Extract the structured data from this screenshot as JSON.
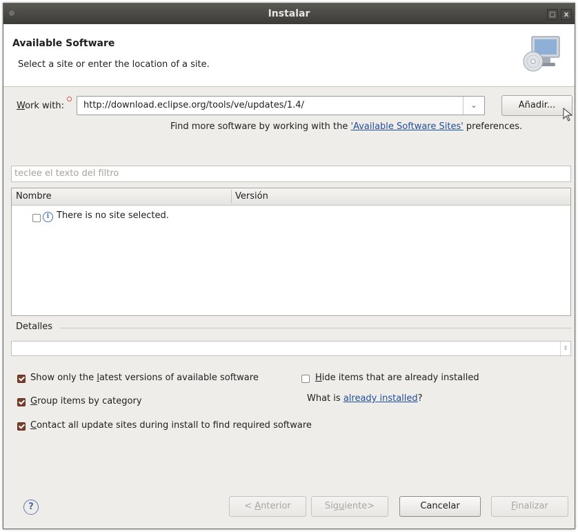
{
  "window": {
    "title": "Instalar",
    "restore_glyph": "◻",
    "close_glyph": "x"
  },
  "header": {
    "title": "Available Software",
    "subtitle": "Select a site or enter the location of a site.",
    "icon": "monitor-cd-icon"
  },
  "work_with": {
    "label_pre": "",
    "label_u": "W",
    "label_post": "ork with:",
    "value": "http://download.eclipse.org/tools/ve/updates/1.4/",
    "caret": "⌄",
    "add_button": "Añadir...",
    "find_more_pre": "Find more software by working with the ",
    "find_more_link": "'Available Software Sites'",
    "find_more_post": " preferences."
  },
  "filter": {
    "placeholder": "teclee el texto del filtro"
  },
  "tree": {
    "columns": [
      "Nombre",
      "Versión"
    ],
    "rows": [
      {
        "label": "There is no site selected.",
        "checked": false,
        "icon": "info-icon",
        "icon_glyph": "i"
      }
    ]
  },
  "details": {
    "label": "Detalles",
    "scroll_glyph": "⇕"
  },
  "options": {
    "latest": {
      "pre": "Show only the ",
      "u": "l",
      "post": "atest versions of available software",
      "checked": true
    },
    "hide_installed": {
      "pre": "",
      "u": "H",
      "post": "ide items that are already installed",
      "checked": false
    },
    "group": {
      "pre": "",
      "u": "G",
      "post": "roup items by category",
      "checked": true
    },
    "what_is_pre": "What is ",
    "what_is_link": "already installed",
    "what_is_post": "?",
    "contact": {
      "pre": "",
      "u": "C",
      "post": "ontact all update sites during install to find required software",
      "checked": true
    }
  },
  "footer": {
    "help_glyph": "?",
    "back": {
      "pre": "< ",
      "u": "A",
      "post": "nterior",
      "enabled": false
    },
    "next": {
      "pre": "Sig",
      "u": "u",
      "post": "iente>",
      "enabled": false
    },
    "cancel": {
      "label": "Cancelar",
      "enabled": true
    },
    "finish": {
      "pre": "",
      "u": "F",
      "post": "inalizar",
      "enabled": false
    }
  },
  "colors": {
    "titlebar": "#3c3b37",
    "link": "#1f4e9c",
    "checkbox_checked": "#7a3e2a",
    "dialog_bg": "#efedea"
  }
}
